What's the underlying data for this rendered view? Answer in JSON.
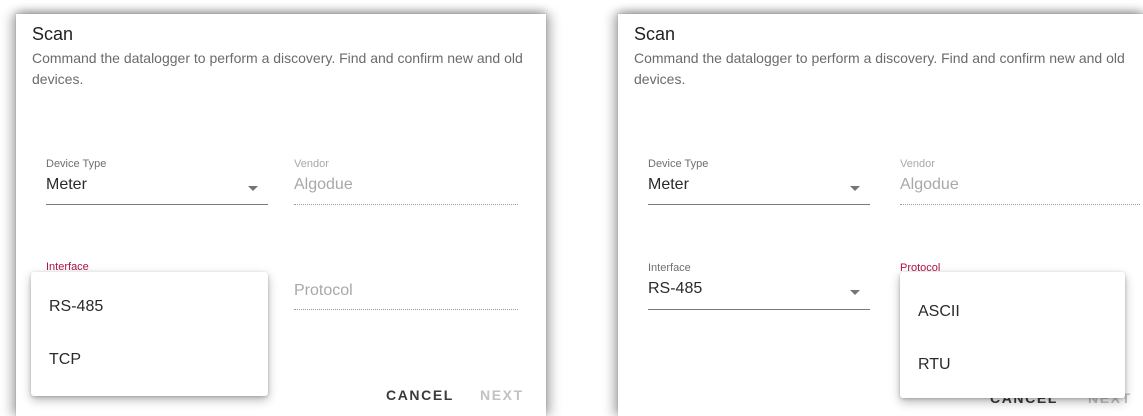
{
  "left_dialog": {
    "title": "Scan",
    "description": "Command the datalogger to perform a discovery. Find and confirm new and old devices.",
    "device_type": {
      "label": "Device Type",
      "value": "Meter"
    },
    "vendor": {
      "label": "Vendor",
      "value": "Algodue"
    },
    "interface": {
      "label": "Interface",
      "options": [
        "RS-485",
        "TCP"
      ]
    },
    "protocol": {
      "placeholder": "Protocol"
    },
    "cancel_label": "CANCEL",
    "next_label": "NEXT"
  },
  "right_dialog": {
    "title": "Scan",
    "description": "Command the datalogger to perform a discovery. Find and confirm new and old devices.",
    "device_type": {
      "label": "Device Type",
      "value": "Meter"
    },
    "vendor": {
      "label": "Vendor",
      "value": "Algodue"
    },
    "interface": {
      "label": "Interface",
      "value": "RS-485"
    },
    "protocol": {
      "label": "Protocol",
      "options": [
        "ASCII",
        "RTU"
      ]
    },
    "cancel_label": "CANCEL",
    "next_label": "NEXT"
  },
  "colors": {
    "focus": "#b0124a",
    "disabled": "#c2c2c2"
  }
}
